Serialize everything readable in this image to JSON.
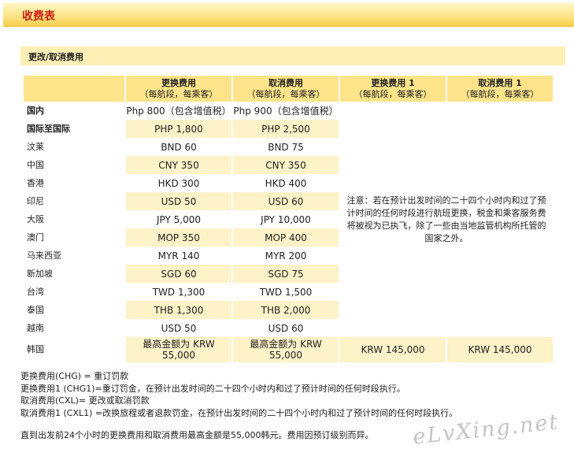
{
  "header": {
    "title": "收费表"
  },
  "section": {
    "title": "更改/取消费用"
  },
  "table": {
    "columns": [
      {
        "title": "更换费用",
        "sub": "（每航段，每乘客）"
      },
      {
        "title": "取消费用",
        "sub": "（每航段，每乘客）"
      },
      {
        "title": "更换费用 1",
        "sub": "（每航段，每乘客）"
      },
      {
        "title": "取消费用 1",
        "sub": "（每航段，每乘客）"
      }
    ],
    "rows": [
      {
        "dest": "国内",
        "change": "Php 800（包含增值税）",
        "cancel": "Php 900（包含增值税）"
      },
      {
        "dest": "国际至国际",
        "change": "PHP 1,800",
        "cancel": "PHP 2,500"
      },
      {
        "dest": "汶莱",
        "change": "BND 60",
        "cancel": "BND 75"
      },
      {
        "dest": "中国",
        "change": "CNY 350",
        "cancel": "CNY 350"
      },
      {
        "dest": "香港",
        "change": "HKD 300",
        "cancel": "HKD 400"
      },
      {
        "dest": "印尼",
        "change": "USD 50",
        "cancel": "USD 60"
      },
      {
        "dest": "大阪",
        "change": "JPY 5,000",
        "cancel": "JPY 10,000"
      },
      {
        "dest": "澳门",
        "change": "MOP 350",
        "cancel": "MOP 400"
      },
      {
        "dest": "马来西亚",
        "change": "MYR 140",
        "cancel": "MYR 200"
      },
      {
        "dest": "新加坡",
        "change": "SGD 60",
        "cancel": "SGD 75"
      },
      {
        "dest": "台湾",
        "change": "TWD 1,300",
        "cancel": "TWD 1,500"
      },
      {
        "dest": "泰国",
        "change": "THB 1,300",
        "cancel": "THB 2,000"
      },
      {
        "dest": "越南",
        "change": "USD 50",
        "cancel": "USD 60"
      }
    ],
    "korea": {
      "dest": "韩国",
      "change_line1": "最高金额为  KRW",
      "change_line2": "55,000",
      "cancel_line1": "最高金额为  KRW",
      "cancel_line2": "55,000",
      "change1": "KRW 145,000",
      "cancel1": "KRW 145,000"
    },
    "note": "注意：若在预计出发时间的二十四个小时内和过了预计时间的任何时段进行航班更换，税金和乘客服务费将被视为已执飞，除了一些由当地监管机构所托管的国家之外。"
  },
  "legend": [
    "更换费用(CHG) = 重订罚款",
    "更换费用1 (CHG1)=重订罚金，在预计出发时间的二十四个小时内和过了预计时间的任何时段执行。",
    "取消费用(CXL)= 更改或取消罚款",
    "取消费用1 (CXL1) =改换旅程或者退款罚金，在预计出发时间的二十四个小时内和过了预计时间的任何时段执行。"
  ],
  "footnote": "直到出发前24个小时的更换费用和取消费用最高金额是55,000韩元。费用因预订级别而异。",
  "watermark": "eLvXing.net"
}
